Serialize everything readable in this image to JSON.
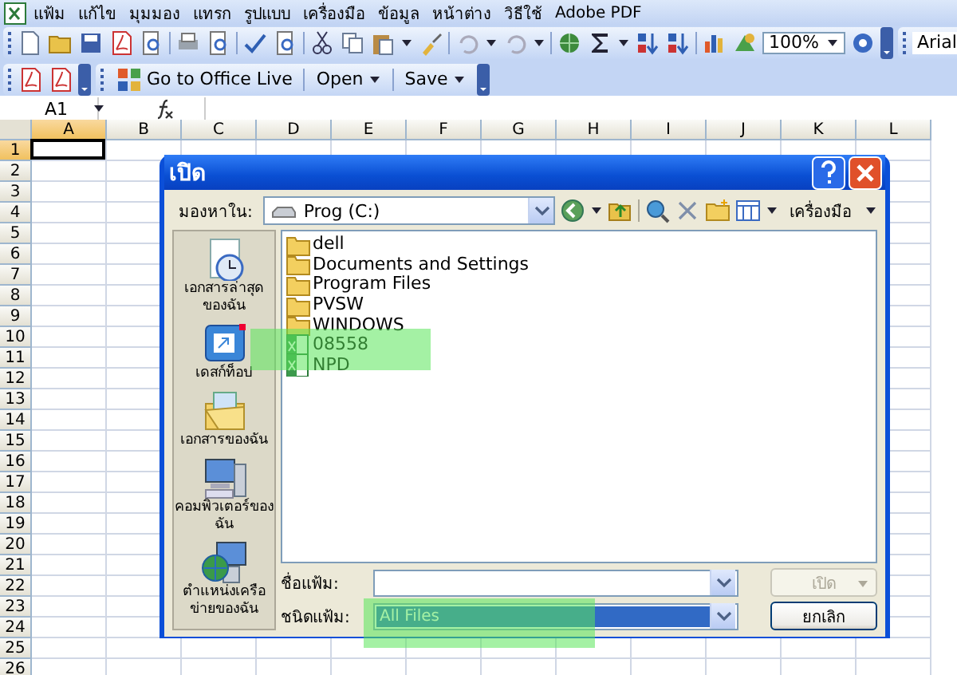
{
  "menu": [
    "แฟ้ม",
    "แก้ไข",
    "มุมมอง",
    "แทรก",
    "รูปแบบ",
    "เครื่องมือ",
    "ข้อมูล",
    "หน้าต่าง",
    "วิธีใช้",
    "Adobe PDF"
  ],
  "toolbar": {
    "zoom": "100%",
    "font": "Arial"
  },
  "toolbar2": {
    "buttons": [
      {
        "label": "Go to Office Live",
        "dropdown": false
      },
      {
        "label": "Open",
        "dropdown": true
      },
      {
        "label": "Save",
        "dropdown": true
      }
    ]
  },
  "formula_bar": {
    "name_box": "A1"
  },
  "sheet": {
    "columns": [
      {
        "label": "A",
        "selected": true
      },
      {
        "label": "B",
        "selected": false
      },
      {
        "label": "C",
        "selected": false
      },
      {
        "label": "D",
        "selected": false
      },
      {
        "label": "E",
        "selected": false
      },
      {
        "label": "F",
        "selected": false
      },
      {
        "label": "G",
        "selected": false
      },
      {
        "label": "H",
        "selected": false
      },
      {
        "label": "I",
        "selected": false
      },
      {
        "label": "J",
        "selected": false
      },
      {
        "label": "K",
        "selected": false
      },
      {
        "label": "L",
        "selected": false
      }
    ],
    "rows": [
      {
        "label": "1",
        "selected": true
      },
      {
        "label": "2",
        "selected": false
      },
      {
        "label": "3",
        "selected": false
      },
      {
        "label": "4",
        "selected": false
      },
      {
        "label": "5",
        "selected": false
      },
      {
        "label": "6",
        "selected": false
      },
      {
        "label": "7",
        "selected": false
      },
      {
        "label": "8",
        "selected": false
      },
      {
        "label": "9",
        "selected": false
      },
      {
        "label": "10",
        "selected": false
      },
      {
        "label": "11",
        "selected": false
      },
      {
        "label": "12",
        "selected": false
      },
      {
        "label": "13",
        "selected": false
      },
      {
        "label": "14",
        "selected": false
      },
      {
        "label": "15",
        "selected": false
      },
      {
        "label": "16",
        "selected": false
      },
      {
        "label": "17",
        "selected": false
      },
      {
        "label": "18",
        "selected": false
      },
      {
        "label": "19",
        "selected": false
      },
      {
        "label": "20",
        "selected": false
      },
      {
        "label": "21",
        "selected": false
      },
      {
        "label": "22",
        "selected": false
      },
      {
        "label": "23",
        "selected": false
      },
      {
        "label": "24",
        "selected": false
      },
      {
        "label": "25",
        "selected": false
      },
      {
        "label": "26",
        "selected": false
      }
    ]
  },
  "dialog": {
    "title": "เปิด",
    "look_in_label": "มองหาใน:",
    "look_in": "Prog (C:)",
    "tools_label": "เครื่องมือ",
    "places": [
      {
        "label": "เอกสารล่าสุดของฉัน",
        "kind": "recent"
      },
      {
        "label": "เดสก์ท็อป",
        "kind": "desktop"
      },
      {
        "label": "เอกสารของฉัน",
        "kind": "documents"
      },
      {
        "label": "คอมพิวเตอร์ของฉัน",
        "kind": "computer"
      },
      {
        "label": "ตำแหน่งเครือข่ายของฉัน",
        "kind": "network"
      }
    ],
    "files": [
      {
        "name": "dell",
        "kind": "folder"
      },
      {
        "name": "Documents and Settings",
        "kind": "folder"
      },
      {
        "name": "Program Files",
        "kind": "folder"
      },
      {
        "name": "PVSW",
        "kind": "folder"
      },
      {
        "name": "WINDOWS",
        "kind": "folder"
      },
      {
        "name": "08558",
        "kind": "workbook"
      },
      {
        "name": "NPD",
        "kind": "workbook"
      }
    ],
    "file_name_label": "ชื่อแฟ้ม:",
    "file_type_label": "ชนิดแฟ้ม:",
    "file_type": "All Files",
    "open_button": {
      "label": "เปิด",
      "disabled": true
    },
    "cancel_button": {
      "label": "ยกเลิก",
      "disabled": false
    }
  }
}
